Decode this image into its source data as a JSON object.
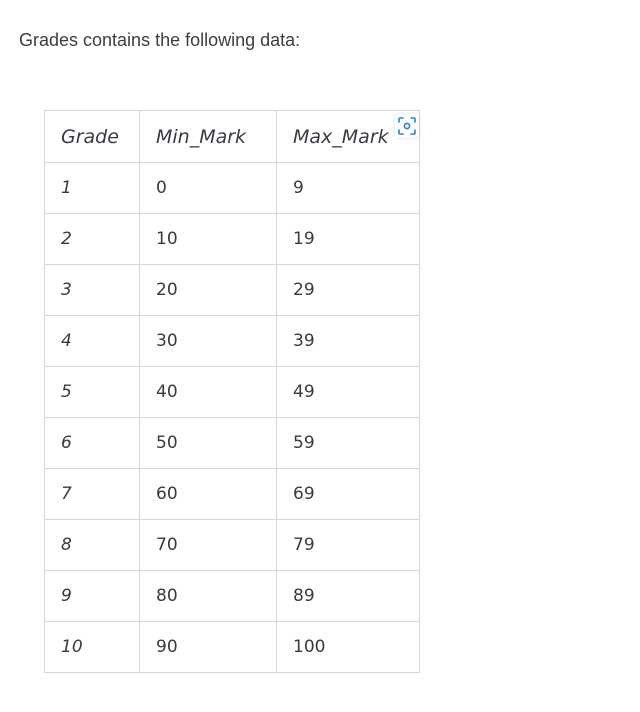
{
  "intro_text": "Grades contains the following data:",
  "table": {
    "headers": [
      "Grade",
      "Min_Mark",
      "Max_Mark"
    ],
    "rows": [
      [
        "1",
        "0",
        "9"
      ],
      [
        "2",
        "10",
        "19"
      ],
      [
        "3",
        "20",
        "29"
      ],
      [
        "4",
        "30",
        "39"
      ],
      [
        "5",
        "40",
        "49"
      ],
      [
        "6",
        "50",
        "59"
      ],
      [
        "7",
        "60",
        "69"
      ],
      [
        "8",
        "70",
        "79"
      ],
      [
        "9",
        "80",
        "89"
      ],
      [
        "10",
        "90",
        "100"
      ]
    ]
  },
  "icons": {
    "scan": "scan-text-icon"
  },
  "colors": {
    "border": "#d6d6dc",
    "icon_accent": "#2b7fd9"
  }
}
